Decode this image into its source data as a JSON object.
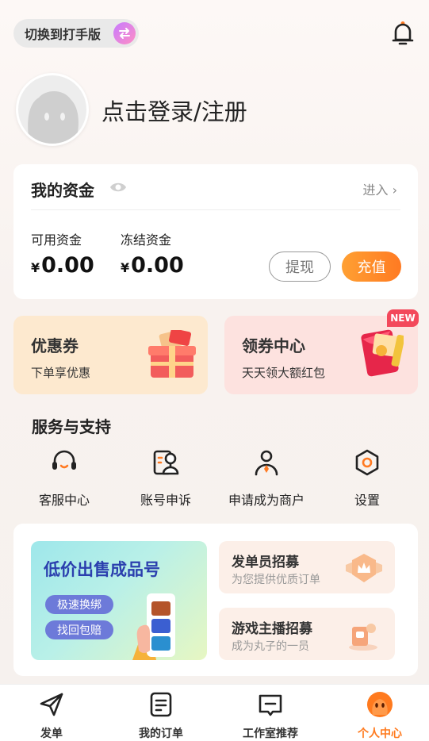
{
  "header": {
    "switch_label": "切换到打手版"
  },
  "profile": {
    "login_text": "点击登录/注册"
  },
  "funds": {
    "title": "我的资金",
    "enter_label": "进入",
    "available_label": "可用资金",
    "available_currency": "¥",
    "available_amount": "0.00",
    "frozen_label": "冻结资金",
    "frozen_currency": "¥",
    "frozen_amount": "0.00",
    "withdraw_label": "提现",
    "recharge_label": "充值"
  },
  "promos": {
    "coupon": {
      "title": "优惠券",
      "subtitle": "下单享优惠"
    },
    "center": {
      "title": "领券中心",
      "subtitle": "天天领大额红包",
      "badge": "NEW"
    }
  },
  "services": {
    "title": "服务与支持",
    "items": [
      {
        "label": "客服中心",
        "icon": "headset-icon"
      },
      {
        "label": "账号申诉",
        "icon": "account-appeal-icon"
      },
      {
        "label": "申请成为商户",
        "icon": "merchant-icon"
      },
      {
        "label": "设置",
        "icon": "settings-icon"
      }
    ]
  },
  "banners": {
    "main": {
      "title": "低价出售成品号",
      "pill1": "极速换绑",
      "pill2": "找回包赔"
    },
    "recruit1": {
      "title": "发单员招募",
      "subtitle": "为您提供优质订单"
    },
    "recruit2": {
      "title": "游戏主播招募",
      "subtitle": "成为丸子的一员"
    }
  },
  "tabbar": {
    "items": [
      {
        "label": "发单",
        "icon": "send-icon"
      },
      {
        "label": "我的订单",
        "icon": "orders-icon"
      },
      {
        "label": "工作室推荐",
        "icon": "studio-icon"
      },
      {
        "label": "个人中心",
        "icon": "profile-icon"
      }
    ],
    "active_index": 3
  },
  "colors": {
    "accent": "#ff7a1e",
    "badge": "#f3485b"
  }
}
